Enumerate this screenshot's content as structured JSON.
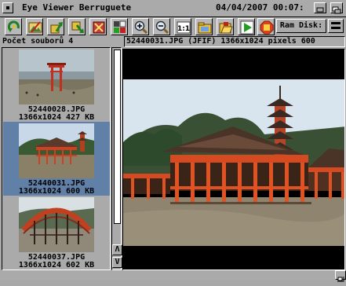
{
  "window": {
    "title": "Eye Viewer Berruguete",
    "datetime": "04/04/2007 00:07:"
  },
  "toolbar": {
    "buttons": [
      {
        "name": "refresh-icon"
      },
      {
        "name": "edit-image-icon"
      },
      {
        "name": "go-up-icon"
      },
      {
        "name": "go-down-icon"
      },
      {
        "name": "delete-icon"
      },
      {
        "name": "palette-icon"
      },
      {
        "name": "zoom-in-icon"
      },
      {
        "name": "zoom-out-icon"
      },
      {
        "name": "zoom-actual-icon",
        "label": "1:1"
      },
      {
        "name": "folder-icon"
      },
      {
        "name": "folder-open-icon"
      },
      {
        "name": "slideshow-play-icon"
      },
      {
        "name": "stop-icon"
      }
    ],
    "drive_selector": "Ram Disk:"
  },
  "file_count": "Počet souborů 4",
  "info_line": "52440031.JPG (JFIF) 1366x1024 pixels 600",
  "thumbnails": [
    {
      "filename": "52440028.JPG",
      "meta": "1366x1024 427 KB",
      "selected": false
    },
    {
      "filename": "52440031.JPG",
      "meta": "1366x1024 600 KB",
      "selected": true
    },
    {
      "filename": "52440037.JPG",
      "meta": "1366x1024 602 KB",
      "selected": false
    }
  ],
  "scroll_arrows": {
    "up": "Λ",
    "down": "V"
  },
  "colors": {
    "chrome": "#aaaaaa",
    "selection": "#6080a8",
    "viewer_bg": "#000000"
  }
}
